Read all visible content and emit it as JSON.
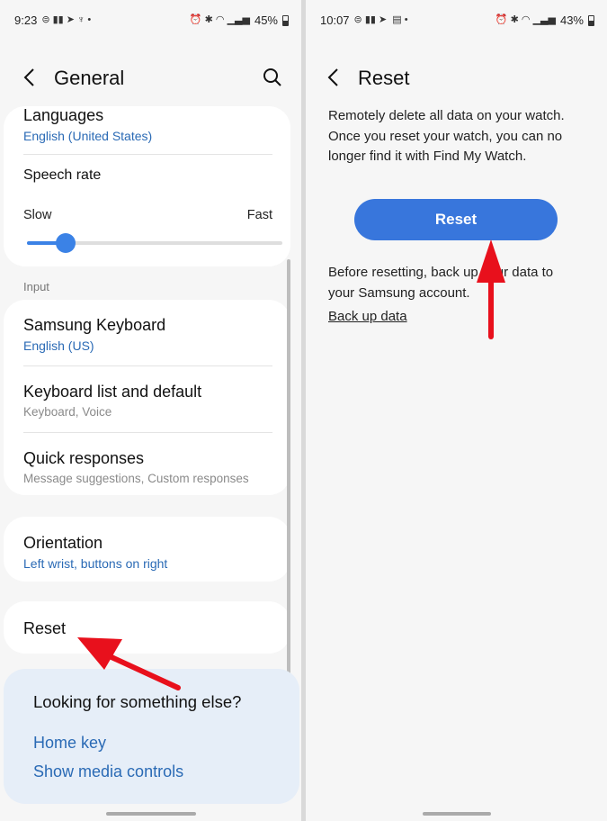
{
  "left": {
    "status": {
      "time": "9:23",
      "battery": "45%"
    },
    "title": "General",
    "languages": {
      "title": "Languages",
      "value": "English (United States)"
    },
    "speech_rate": {
      "title": "Speech rate",
      "min_label": "Slow",
      "max_label": "Fast",
      "level": 0.15
    },
    "input_label": "Input",
    "samsung_keyboard": {
      "title": "Samsung Keyboard",
      "value": "English (US)"
    },
    "keyboard_list": {
      "title": "Keyboard list and default",
      "value": "Keyboard, Voice"
    },
    "quick_responses": {
      "title": "Quick responses",
      "value": "Message suggestions, Custom responses"
    },
    "orientation": {
      "title": "Orientation",
      "value": "Left wrist, buttons on right"
    },
    "reset": {
      "title": "Reset"
    },
    "suggestions": {
      "title": "Looking for something else?",
      "links": [
        "Home key",
        "Show media controls"
      ]
    }
  },
  "right": {
    "status": {
      "time": "10:07",
      "battery": "43%"
    },
    "title": "Reset",
    "description": "Remotely delete all data on your watch. Once you reset your watch, you can no longer find it with Find My Watch.",
    "reset_button": "Reset",
    "backup_note": "Before resetting, back up your data to your Samsung account.",
    "backup_link": "Back up data"
  },
  "colors": {
    "accent": "#3876dc",
    "link": "#2a6ab5",
    "annotation": "#e8101c"
  }
}
